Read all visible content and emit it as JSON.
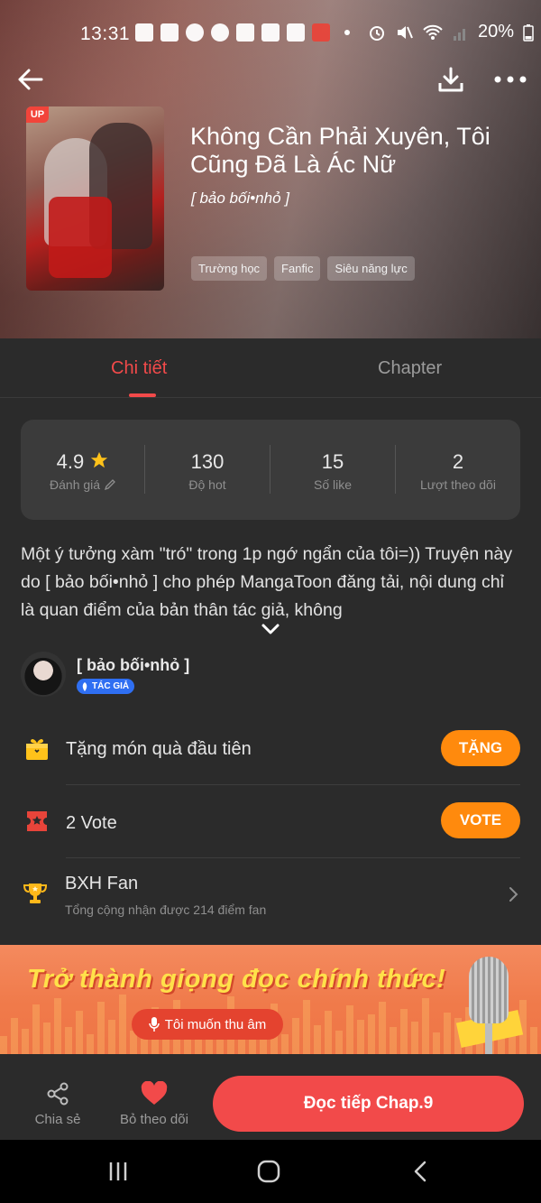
{
  "status_bar": {
    "time": "13:31",
    "battery": "20%",
    "icons": [
      "message-icon",
      "facebook-icon",
      "app-icon",
      "chat-bubble-icon",
      "tiktok-icon",
      "shield-icon",
      "shield-icon",
      "mangatoon-icon",
      "dot-icon"
    ],
    "right_icons": [
      "alarm-icon",
      "mute-icon",
      "wifi-icon",
      "signal-icon",
      "battery-icon"
    ]
  },
  "book": {
    "cover_badge": "UP",
    "title": "Không Cần Phải Xuyên, Tôi Cũng Đã Là Ác Nữ",
    "author": "[ bảo bối•nhỏ ]",
    "tags": [
      "Trường học",
      "Fanfic",
      "Siêu năng lực"
    ]
  },
  "tabs": [
    {
      "label": "Chi tiết",
      "active": true
    },
    {
      "label": "Chapter",
      "active": false
    }
  ],
  "stats": [
    {
      "value": "4.9",
      "label": "Đánh giá",
      "icon": "star-icon"
    },
    {
      "value": "130",
      "label": "Độ hot"
    },
    {
      "value": "15",
      "label": "Số like"
    },
    {
      "value": "2",
      "label": "Lượt theo dõi"
    }
  ],
  "description": "Một ý tưởng xàm \"tró\" trong 1p ngớ ngẩn của tôi=)) Truyện này do [ bảo bối•nhỏ ] cho phép MangaToon đăng tải, nội dung chỉ là quan điểm của bản thân tác giả, không",
  "author_section": {
    "name": "[ bảo bối•nhỏ ]",
    "badge": "TÁC GIẢ"
  },
  "gift": {
    "text": "Tặng món quà đầu tiên",
    "button": "TẶNG"
  },
  "vote": {
    "text": "2 Vote",
    "button": "VOTE"
  },
  "fan_ranking": {
    "title": "BXH Fan",
    "subtitle": "Tổng cộng nhận được 214 điểm fan"
  },
  "banner": {
    "title": "Trở thành giọng đọc chính thức!",
    "button": "Tôi muốn thu âm"
  },
  "bottom_bar": {
    "share": "Chia sẻ",
    "unfollow": "Bỏ theo dõi",
    "read": "Đọc tiếp Chap.9"
  },
  "colors": {
    "accent_red": "#f24a4a",
    "accent_orange": "#ff8a0d",
    "background": "#2b2b2b",
    "card": "#3b3b3b"
  }
}
